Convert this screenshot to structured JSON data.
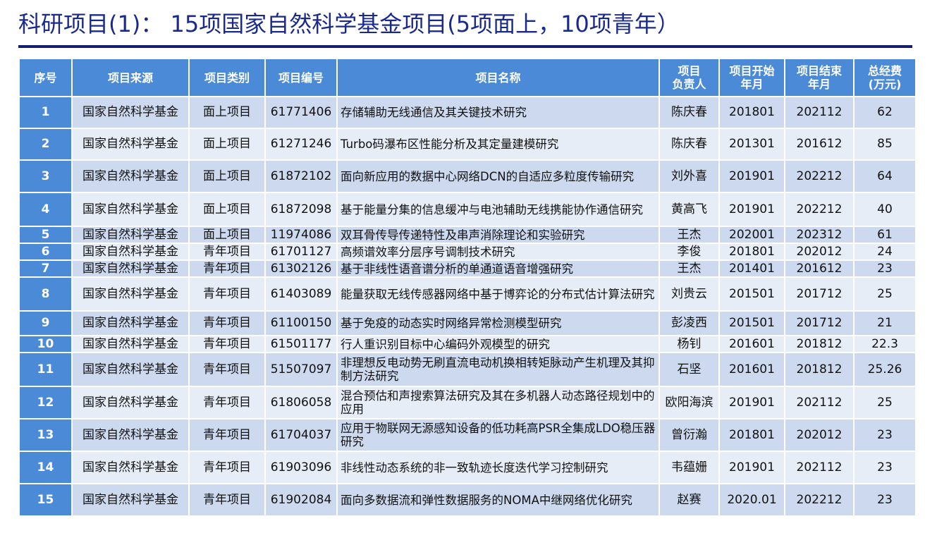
{
  "page_title": "科研项目(1)：  15项国家自然科学基金项目(5项面上，10项青年）",
  "headers": {
    "seq": "序号",
    "source": "项目来源",
    "category": "项目类别",
    "code": "项目编号",
    "name": "项目名称",
    "leader_line1": "项目",
    "leader_line2": "负责人",
    "start_line1": "项目开始",
    "start_line2": "年月",
    "end_line1": "项目结束",
    "end_line2": "年月",
    "fund_line1": "总经费",
    "fund_line2": "(万元)"
  },
  "rows": [
    {
      "seq": "1",
      "source": "国家自然科学基金",
      "category": "面上项目",
      "code": "61771406",
      "name": "存储辅助无线通信及其关键技术研究",
      "leader": "陈庆春",
      "start": "201801",
      "end": "202112",
      "fund": "62"
    },
    {
      "seq": "2",
      "source": "国家自然科学基金",
      "category": "面上项目",
      "code": "61271246",
      "name": "Turbo码瀑布区性能分析及其定量建模研究",
      "leader": "陈庆春",
      "start": "201301",
      "end": "201612",
      "fund": "85"
    },
    {
      "seq": "3",
      "source": "国家自然科学基金",
      "category": "面上项目",
      "code": "61872102",
      "name": "面向新应用的数据中心网络DCN的自适应多粒度传输研究",
      "leader": "刘外喜",
      "start": "201901",
      "end": "202212",
      "fund": "64"
    },
    {
      "seq": "4",
      "source": "国家自然科学基金",
      "category": "面上项目",
      "code": "61872098",
      "name": "基于能量分集的信息缓冲与电池辅助无线携能协作通信研究",
      "leader": "黄高飞",
      "start": "201901",
      "end": "202212",
      "fund": "40"
    },
    {
      "seq": "5",
      "source": "国家自然科学基金",
      "category": "面上项目",
      "code": "11974086",
      "name": "双耳骨传导传递特性及串声消除理论和实验研究",
      "leader": "王杰",
      "start": "202001",
      "end": "202312",
      "fund": "61"
    },
    {
      "seq": "6",
      "source": "国家自然科学基金",
      "category": "青年项目",
      "code": "61701127",
      "name": "高频谱效率分层序号调制技术研究",
      "leader": "李俊",
      "start": "201801",
      "end": "202012",
      "fund": "24"
    },
    {
      "seq": "7",
      "source": "国家自然科学基金",
      "category": "青年项目",
      "code": "61302126",
      "name": "基于非线性语音谱分析的单通道语音增强研究",
      "leader": "王杰",
      "start": "201401",
      "end": "201612",
      "fund": "23"
    },
    {
      "seq": "8",
      "source": "国家自然科学基金",
      "category": "青年项目",
      "code": "61403089",
      "name": "能量获取无线传感器网络中基于博弈论的分布式估计算法研究",
      "leader": "刘贵云",
      "start": "201501",
      "end": "201712",
      "fund": "25"
    },
    {
      "seq": "9",
      "source": "国家自然科学基金",
      "category": "青年项目",
      "code": "61100150",
      "name": "基于免疫的动态实时网络异常检测模型研究",
      "leader": "彭凌西",
      "start": "201501",
      "end": "201712",
      "fund": "21"
    },
    {
      "seq": "10",
      "source": "国家自然科学基金",
      "category": "青年项目",
      "code": "61501177",
      "name": "行人重识别目标中心编码外观模型的研究",
      "leader": "杨钊",
      "start": "201601",
      "end": "201812",
      "fund": "22.3"
    },
    {
      "seq": "11",
      "source": "国家自然科学基金",
      "category": "青年项目",
      "code": "51507097",
      "name": "非理想反电动势无刷直流电动机换相转矩脉动产生机理及其抑制方法研究",
      "leader": "石坚",
      "start": "201601",
      "end": "201812",
      "fund": "25.26"
    },
    {
      "seq": "12",
      "source": "国家自然科学基金",
      "category": "青年项目",
      "code": "61806058",
      "name": "混合预估和声搜索算法研究及其在多机器人动态路径规划中的应用",
      "leader": "欧阳海滨",
      "start": "201901",
      "end": "202112",
      "fund": "25"
    },
    {
      "seq": "13",
      "source": "国家自然科学基金",
      "category": "青年项目",
      "code": "61704037",
      "name": "应用于物联网无源感知设备的低功耗高PSR全集成LDO稳压器研究",
      "leader": "曾衍瀚",
      "start": "201801",
      "end": "202012",
      "fund": "23"
    },
    {
      "seq": "14",
      "source": "国家自然科学基金",
      "category": "青年项目",
      "code": "61903096",
      "name": "非线性动态系统的非一致轨迹长度迭代学习控制研究",
      "leader": "韦蕴姗",
      "start": "201901",
      "end": "202112",
      "fund": "23"
    },
    {
      "seq": "15",
      "source": "国家自然科学基金",
      "category": "青年项目",
      "code": "61902084",
      "name": "面向多数据流和弹性数据服务的NOMA中继网络优化研究",
      "leader": "赵赛",
      "start": "2020.01",
      "end": "202212",
      "fund": "23"
    }
  ]
}
